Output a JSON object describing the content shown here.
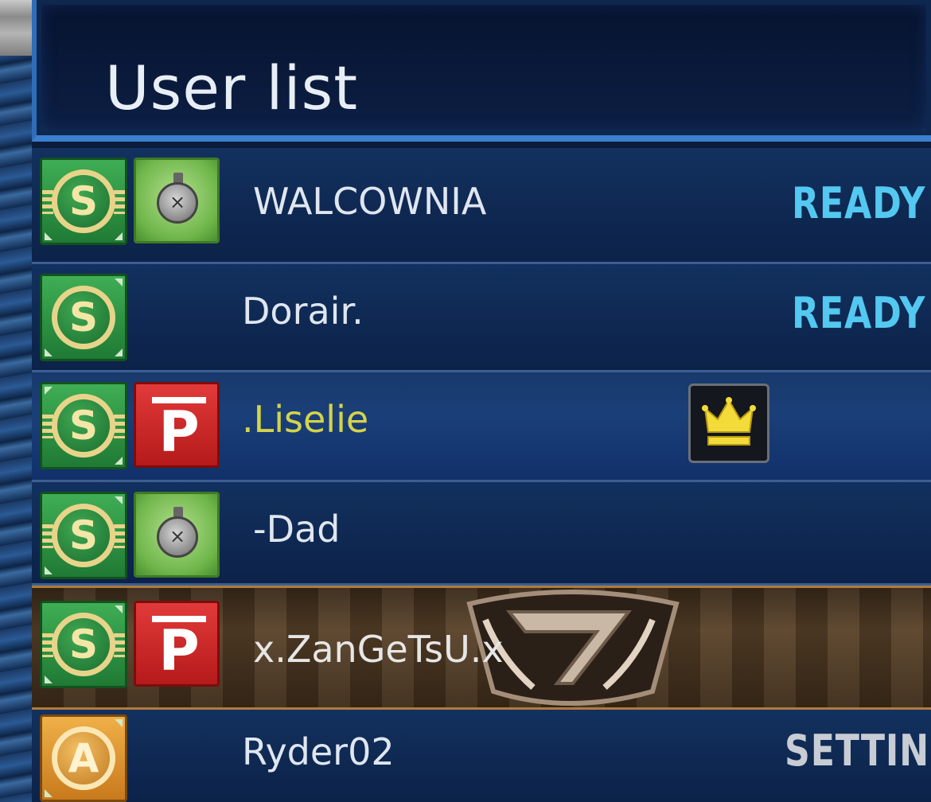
{
  "header": {
    "title": "User list"
  },
  "users": [
    {
      "name": "WALCOWNIA",
      "status": "READY"
    },
    {
      "name": "Dorair.",
      "status": "READY"
    },
    {
      "name": ".Liselie",
      "status": ""
    },
    {
      "name": "-Dad",
      "status": ""
    },
    {
      "name": "x.ZanGeTsU.x",
      "status": ""
    },
    {
      "name": "Ryder02",
      "status": "SETTING"
    }
  ],
  "icons": {
    "rank_s": "S",
    "rank_a": "A",
    "premium": "P",
    "timer": "stopwatch-icon",
    "room_master": "crown-icon"
  },
  "colors": {
    "ready": "#53c8f0",
    "setting": "#c8ccd4",
    "host_name": "#d4d44a",
    "header_border": "#3b7fd0"
  }
}
